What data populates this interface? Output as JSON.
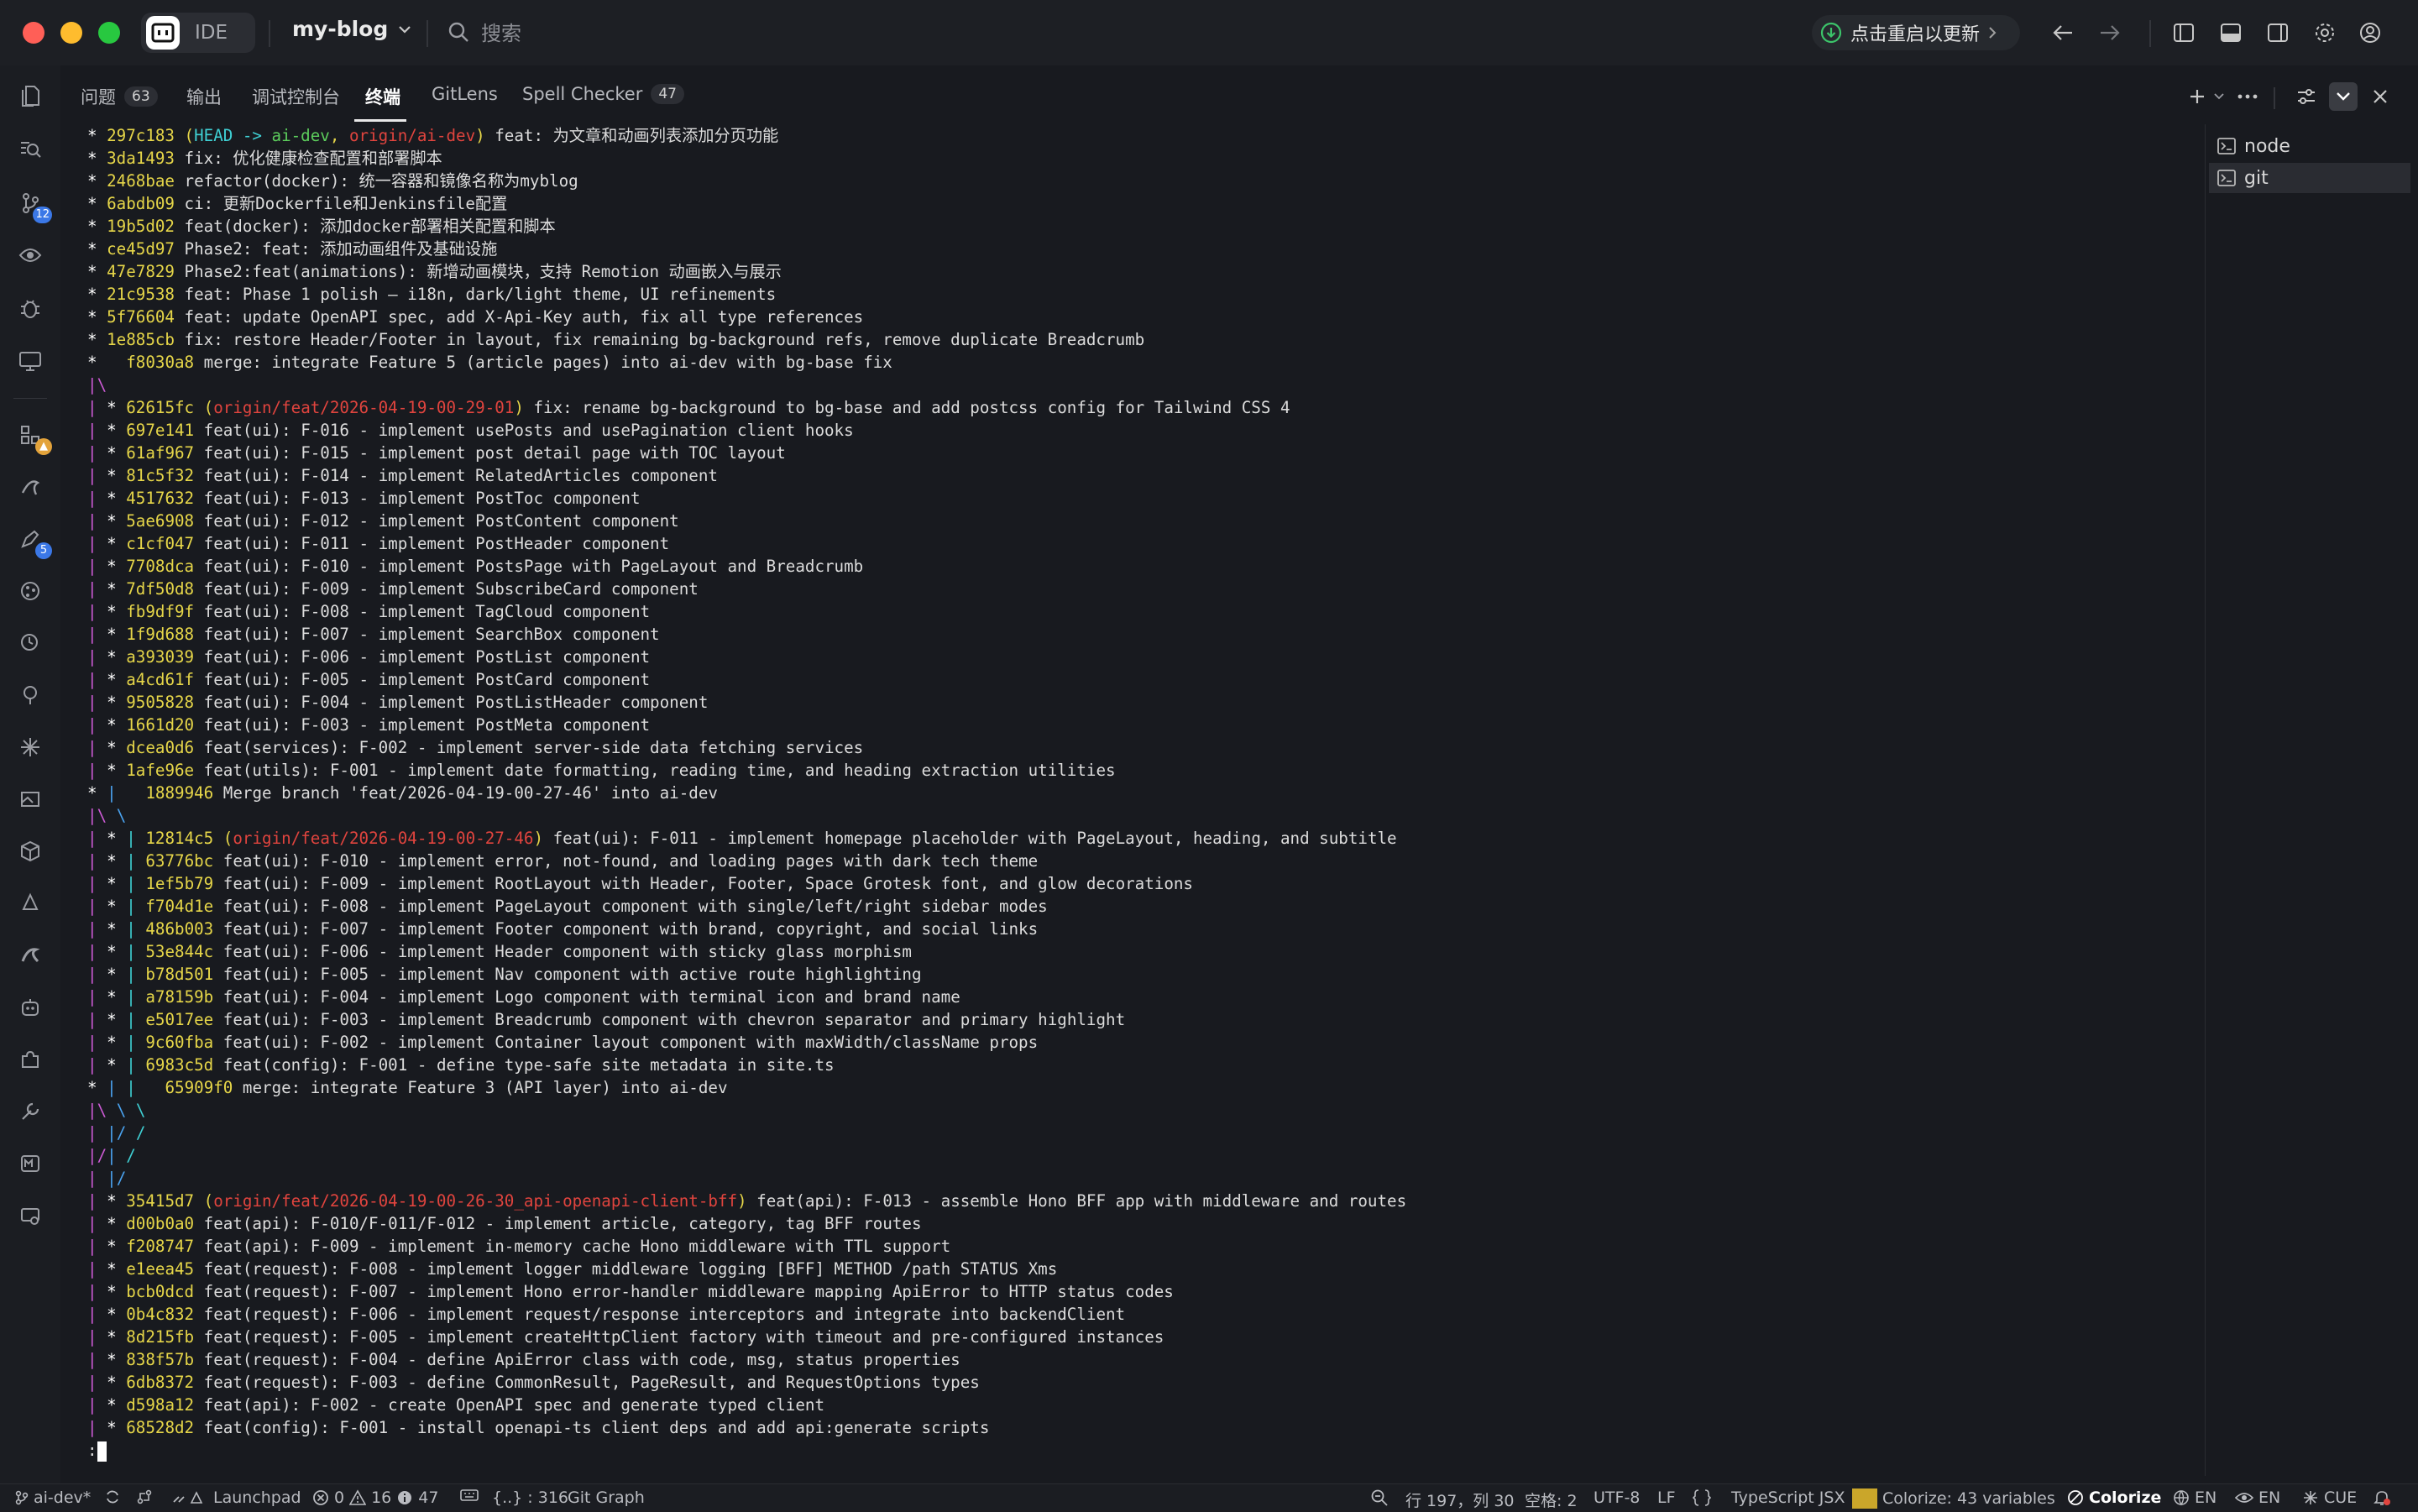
{
  "titlebar": {
    "ide_label": "IDE",
    "project": "my-blog",
    "search_placeholder": "搜索",
    "update_label": "点击重启以更新"
  },
  "activity": {
    "source_control_badge": "12",
    "extension_badge": "5"
  },
  "tabs": [
    {
      "label": "问题",
      "count": "63"
    },
    {
      "label": "输出"
    },
    {
      "label": "调试控制台"
    },
    {
      "label": "终端"
    },
    {
      "label": "GitLens"
    },
    {
      "label": "Spell Checker",
      "count": "47"
    }
  ],
  "terminal_list": [
    {
      "label": "node"
    },
    {
      "label": "git"
    }
  ],
  "terminal_lines": [
    {
      "g": "* ",
      "h": "297c183",
      "r": [
        {
          "t": " (",
          "c": "g-yellow"
        },
        {
          "t": "HEAD -> ",
          "c": "g-cyan"
        },
        {
          "t": "ai-dev",
          "c": "g-green"
        },
        {
          "t": ", ",
          "c": "g-yellow"
        },
        {
          "t": "origin/ai-dev",
          "c": "g-red"
        },
        {
          "t": ")",
          "c": "g-yellow"
        },
        {
          "t": " feat: 为文章和动画列表添加分页功能"
        }
      ]
    },
    {
      "g": "* ",
      "h": "3da1493",
      "r": [
        {
          "t": " fix: 优化健康检查配置和部署脚本"
        }
      ]
    },
    {
      "g": "* ",
      "h": "2468bae",
      "r": [
        {
          "t": " refactor(docker): 统一容器和镜像名称为myblog"
        }
      ]
    },
    {
      "g": "* ",
      "h": "6abdb09",
      "r": [
        {
          "t": " ci: 更新Dockerfile和Jenkinsfile配置"
        }
      ]
    },
    {
      "g": "* ",
      "h": "19b5d02",
      "r": [
        {
          "t": " feat(docker): 添加docker部署相关配置和脚本"
        }
      ]
    },
    {
      "g": "* ",
      "h": "ce45d97",
      "r": [
        {
          "t": " Phase2: feat: 添加动画组件及基础设施"
        }
      ]
    },
    {
      "g": "* ",
      "h": "47e7829",
      "r": [
        {
          "t": " Phase2:feat(animations): 新增动画模块，支持 Remotion 动画嵌入与展示"
        }
      ]
    },
    {
      "g": "* ",
      "h": "21c9538",
      "r": [
        {
          "t": " feat: Phase 1 polish — i18n, dark/light theme, UI refinements"
        }
      ]
    },
    {
      "g": "* ",
      "h": "5f76604",
      "r": [
        {
          "t": " feat: update OpenAPI spec, add X-Api-Key auth, fix all type references"
        }
      ]
    },
    {
      "g": "* ",
      "h": "1e885cb",
      "r": [
        {
          "t": " fix: restore Header/Footer in layout, fix remaining bg-background refs, remove duplicate Breadcrumb"
        }
      ]
    },
    {
      "g": "*   ",
      "h": "f8030a8",
      "r": [
        {
          "t": " merge: integrate Feature 5 (article pages) into ai-dev with bg-base fix"
        }
      ]
    },
    {
      "g": "|\\",
      "h": "",
      "r": []
    },
    {
      "g": "| * ",
      "h": "62615fc",
      "r": [
        {
          "t": " (",
          "c": "g-yellow"
        },
        {
          "t": "origin/feat/2026-04-19-00-29-01",
          "c": "g-red"
        },
        {
          "t": ")",
          "c": "g-yellow"
        },
        {
          "t": " fix: rename bg-background to bg-base and add postcss config for Tailwind CSS 4"
        }
      ]
    },
    {
      "g": "| * ",
      "h": "697e141",
      "r": [
        {
          "t": " feat(ui): F-016 - implement usePosts and usePagination client hooks"
        }
      ]
    },
    {
      "g": "| * ",
      "h": "61af967",
      "r": [
        {
          "t": " feat(ui): F-015 - implement post detail page with TOC layout"
        }
      ]
    },
    {
      "g": "| * ",
      "h": "81c5f32",
      "r": [
        {
          "t": " feat(ui): F-014 - implement RelatedArticles component"
        }
      ]
    },
    {
      "g": "| * ",
      "h": "4517632",
      "r": [
        {
          "t": " feat(ui): F-013 - implement PostToc component"
        }
      ]
    },
    {
      "g": "| * ",
      "h": "5ae6908",
      "r": [
        {
          "t": " feat(ui): F-012 - implement PostContent component"
        }
      ]
    },
    {
      "g": "| * ",
      "h": "c1cf047",
      "r": [
        {
          "t": " feat(ui): F-011 - implement PostHeader component"
        }
      ]
    },
    {
      "g": "| * ",
      "h": "7708dca",
      "r": [
        {
          "t": " feat(ui): F-010 - implement PostsPage with PageLayout and Breadcrumb"
        }
      ]
    },
    {
      "g": "| * ",
      "h": "7df50d8",
      "r": [
        {
          "t": " feat(ui): F-009 - implement SubscribeCard component"
        }
      ]
    },
    {
      "g": "| * ",
      "h": "fb9df9f",
      "r": [
        {
          "t": " feat(ui): F-008 - implement TagCloud component"
        }
      ]
    },
    {
      "g": "| * ",
      "h": "1f9d688",
      "r": [
        {
          "t": " feat(ui): F-007 - implement SearchBox component"
        }
      ]
    },
    {
      "g": "| * ",
      "h": "a393039",
      "r": [
        {
          "t": " feat(ui): F-006 - implement PostList component"
        }
      ]
    },
    {
      "g": "| * ",
      "h": "a4cd61f",
      "r": [
        {
          "t": " feat(ui): F-005 - implement PostCard component"
        }
      ]
    },
    {
      "g": "| * ",
      "h": "9505828",
      "r": [
        {
          "t": " feat(ui): F-004 - implement PostListHeader component"
        }
      ]
    },
    {
      "g": "| * ",
      "h": "1661d20",
      "r": [
        {
          "t": " feat(ui): F-003 - implement PostMeta component"
        }
      ]
    },
    {
      "g": "| * ",
      "h": "dcea0d6",
      "r": [
        {
          "t": " feat(services): F-002 - implement server-side data fetching services"
        }
      ]
    },
    {
      "g": "| * ",
      "h": "1afe96e",
      "r": [
        {
          "t": " feat(utils): F-001 - implement date formatting, reading time, and heading extraction utilities"
        }
      ]
    },
    {
      "g": "* |   ",
      "h": "1889946",
      "r": [
        {
          "t": " Merge branch 'feat/2026-04-19-00-27-46' into ai-dev"
        }
      ]
    },
    {
      "g": "|\\ \\",
      "h": "",
      "r": []
    },
    {
      "g": "| * | ",
      "h": "12814c5",
      "r": [
        {
          "t": " (",
          "c": "g-yellow"
        },
        {
          "t": "origin/feat/2026-04-19-00-27-46",
          "c": "g-red"
        },
        {
          "t": ")",
          "c": "g-yellow"
        },
        {
          "t": " feat(ui): F-011 - implement homepage placeholder with PageLayout, heading, and subtitle"
        }
      ]
    },
    {
      "g": "| * | ",
      "h": "63776bc",
      "r": [
        {
          "t": " feat(ui): F-010 - implement error, not-found, and loading pages with dark tech theme"
        }
      ]
    },
    {
      "g": "| * | ",
      "h": "1ef5b79",
      "r": [
        {
          "t": " feat(ui): F-009 - implement RootLayout with Header, Footer, Space Grotesk font, and glow decorations"
        }
      ]
    },
    {
      "g": "| * | ",
      "h": "f704d1e",
      "r": [
        {
          "t": " feat(ui): F-008 - implement PageLayout component with single/left/right sidebar modes"
        }
      ]
    },
    {
      "g": "| * | ",
      "h": "486b003",
      "r": [
        {
          "t": " feat(ui): F-007 - implement Footer component with brand, copyright, and social links"
        }
      ]
    },
    {
      "g": "| * | ",
      "h": "53e844c",
      "r": [
        {
          "t": " feat(ui): F-006 - implement Header component with sticky glass morphism"
        }
      ]
    },
    {
      "g": "| * | ",
      "h": "b78d501",
      "r": [
        {
          "t": " feat(ui): F-005 - implement Nav component with active route highlighting"
        }
      ]
    },
    {
      "g": "| * | ",
      "h": "a78159b",
      "r": [
        {
          "t": " feat(ui): F-004 - implement Logo component with terminal icon and brand name"
        }
      ]
    },
    {
      "g": "| * | ",
      "h": "e5017ee",
      "r": [
        {
          "t": " feat(ui): F-003 - implement Breadcrumb component with chevron separator and primary highlight"
        }
      ]
    },
    {
      "g": "| * | ",
      "h": "9c60fba",
      "r": [
        {
          "t": " feat(ui): F-002 - implement Container layout component with maxWidth/className props"
        }
      ]
    },
    {
      "g": "| * | ",
      "h": "6983c5d",
      "r": [
        {
          "t": " feat(config): F-001 - define type-safe site metadata in site.ts"
        }
      ]
    },
    {
      "g": "* | |   ",
      "h": "65909f0",
      "r": [
        {
          "t": " merge: integrate Feature 3 (API layer) into ai-dev"
        }
      ]
    },
    {
      "g": "|\\ \\ \\",
      "h": "",
      "r": []
    },
    {
      "g": "| |/ /",
      "h": "",
      "r": []
    },
    {
      "g": "|/| /",
      "h": "",
      "r": []
    },
    {
      "g": "| |/",
      "h": "",
      "r": []
    },
    {
      "g": "| * ",
      "h": "35415d7",
      "r": [
        {
          "t": " (",
          "c": "g-yellow"
        },
        {
          "t": "origin/feat/2026-04-19-00-26-30_api-openapi-client-bff",
          "c": "g-red"
        },
        {
          "t": ")",
          "c": "g-yellow"
        },
        {
          "t": " feat(api): F-013 - assemble Hono BFF app with middleware and routes"
        }
      ]
    },
    {
      "g": "| * ",
      "h": "d00b0a0",
      "r": [
        {
          "t": " feat(api): F-010/F-011/F-012 - implement article, category, tag BFF routes"
        }
      ]
    },
    {
      "g": "| * ",
      "h": "f208747",
      "r": [
        {
          "t": " feat(api): F-009 - implement in-memory cache Hono middleware with TTL support"
        }
      ]
    },
    {
      "g": "| * ",
      "h": "e1eea45",
      "r": [
        {
          "t": " feat(request): F-008 - implement logger middleware logging [BFF] METHOD /path STATUS Xms"
        }
      ]
    },
    {
      "g": "| * ",
      "h": "bcb0dcd",
      "r": [
        {
          "t": " feat(request): F-007 - implement Hono error-handler middleware mapping ApiError to HTTP status codes"
        }
      ]
    },
    {
      "g": "| * ",
      "h": "0b4c832",
      "r": [
        {
          "t": " feat(request): F-006 - implement request/response interceptors and integrate into backendClient"
        }
      ]
    },
    {
      "g": "| * ",
      "h": "8d215fb",
      "r": [
        {
          "t": " feat(request): F-005 - implement createHttpClient factory with timeout and pre-configured instances"
        }
      ]
    },
    {
      "g": "| * ",
      "h": "838f57b",
      "r": [
        {
          "t": " feat(request): F-004 - define ApiError class with code, msg, status properties"
        }
      ]
    },
    {
      "g": "| * ",
      "h": "6db8372",
      "r": [
        {
          "t": " feat(request): F-003 - define CommonResult, PageResult, and RequestOptions types"
        }
      ]
    },
    {
      "g": "| * ",
      "h": "d598a12",
      "r": [
        {
          "t": " feat(api): F-002 - create OpenAPI spec and generate typed client"
        }
      ]
    },
    {
      "g": "| * ",
      "h": "68528d2",
      "r": [
        {
          "t": " feat(config): F-001 - install openapi-ts client deps and add api:generate scripts"
        }
      ]
    }
  ],
  "prompt": ":",
  "status": {
    "branch": "ai-dev*",
    "launchpad": "Launchpad",
    "errors": "0",
    "warnings": "16",
    "infos": "47",
    "symbols": "{..} : 316",
    "git_graph": "Git Graph",
    "cursor_pos": "行 197，列 30",
    "indent": "空格: 2",
    "encoding": "UTF-8",
    "eol": "LF",
    "language": "TypeScript JSX",
    "colorize_vars": "Colorize: 43 variables",
    "colorize": "Colorize",
    "lang1": "EN",
    "lang2": "EN",
    "cue": "CUE"
  },
  "colors": {
    "hash": "#e6d649",
    "ref_red": "#e0443e",
    "head_cyan": "#3fd0d4",
    "branch_green": "#5ccd5c",
    "graph_magenta": "#cc5bd5",
    "badge_blue": "#3b78e7"
  }
}
